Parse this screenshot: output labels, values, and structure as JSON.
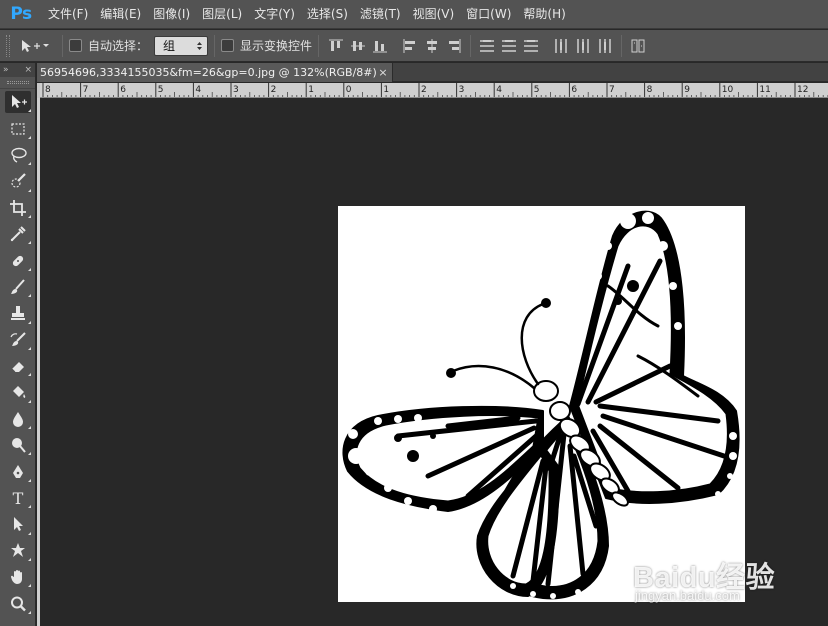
{
  "app": {
    "logo": "Ps",
    "accent_color": "#31a8ff"
  },
  "menu": [
    {
      "label": "文件(F)"
    },
    {
      "label": "编辑(E)"
    },
    {
      "label": "图像(I)"
    },
    {
      "label": "图层(L)"
    },
    {
      "label": "文字(Y)"
    },
    {
      "label": "选择(S)"
    },
    {
      "label": "滤镜(T)"
    },
    {
      "label": "视图(V)"
    },
    {
      "label": "窗口(W)"
    },
    {
      "label": "帮助(H)"
    }
  ],
  "options_bar": {
    "tool_preset_icon": "move-tool-icon",
    "auto_select_label": "自动选择：",
    "auto_select_checked": false,
    "auto_select_target": "组",
    "show_transform_label": "显示变换控件",
    "show_transform_checked": false,
    "align_icons": [
      "align-top-icon",
      "align-vcenter-icon",
      "align-bottom-icon",
      "align-left-icon",
      "align-hcenter-icon",
      "align-right-icon",
      "distribute-top-icon",
      "distribute-vcenter-icon",
      "distribute-bottom-icon",
      "distribute-left-icon",
      "distribute-hcenter-icon",
      "distribute-right-icon",
      "auto-align-icon"
    ]
  },
  "toolbar": {
    "collapse_glyph": "»",
    "close_glyph": "×",
    "tools": [
      {
        "name": "move-tool-icon",
        "active": true
      },
      {
        "name": "marquee-tool-icon"
      },
      {
        "name": "lasso-tool-icon"
      },
      {
        "name": "quick-select-tool-icon"
      },
      {
        "name": "crop-tool-icon"
      },
      {
        "name": "eyedropper-tool-icon"
      },
      {
        "name": "healing-brush-tool-icon"
      },
      {
        "name": "brush-tool-icon"
      },
      {
        "name": "clone-stamp-tool-icon"
      },
      {
        "name": "history-brush-tool-icon"
      },
      {
        "name": "eraser-tool-icon"
      },
      {
        "name": "paint-bucket-tool-icon"
      },
      {
        "name": "blur-tool-icon"
      },
      {
        "name": "dodge-tool-icon"
      },
      {
        "name": "pen-tool-icon"
      },
      {
        "name": "type-tool-icon"
      },
      {
        "name": "path-select-tool-icon"
      },
      {
        "name": "custom-shape-tool-icon"
      },
      {
        "name": "hand-tool-icon"
      },
      {
        "name": "zoom-tool-icon"
      }
    ]
  },
  "document": {
    "tab_title": "56954696,3334155035&fm=26&gp=0.jpg @ 132%(RGB/8#)",
    "close_glyph": "×",
    "zoom_percent": 132,
    "color_mode": "RGB/8#"
  },
  "ruler": {
    "labels": [
      "8",
      "7",
      "6",
      "5",
      "4",
      "3",
      "2",
      "1",
      "0",
      "1",
      "2",
      "3",
      "4",
      "5",
      "6",
      "7",
      "8",
      "9",
      "10",
      "11",
      "12"
    ]
  },
  "watermark": {
    "brand": "Baidu",
    "product": "经验",
    "url": "jingyan.baidu.com"
  }
}
